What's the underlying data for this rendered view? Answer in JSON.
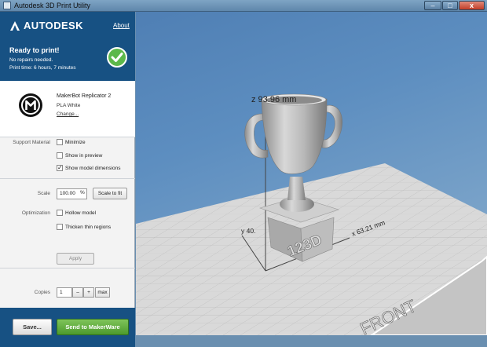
{
  "window": {
    "title": "Autodesk 3D Print Utility",
    "controls": {
      "minimize": "–",
      "maximize": "□",
      "close": "x"
    }
  },
  "brand": {
    "logo_text": "AUTODESK",
    "about_link": "About",
    "accent_color": "#175183"
  },
  "status": {
    "title": "Ready to print!",
    "repairs": "No repairs needed.",
    "print_time": "Print time: 6 hours, 7 minutes",
    "icon": "check-icon",
    "color": "#5cb84a"
  },
  "printer": {
    "name": "MakerBot Replicator 2",
    "material": "PLA White",
    "change_link": "Change..."
  },
  "support_material": {
    "label": "Support Material",
    "options": [
      {
        "label": "Minimize",
        "checked": false
      },
      {
        "label": "Show in preview",
        "checked": false
      },
      {
        "label": "Show model dimensions",
        "checked": true
      }
    ]
  },
  "scale": {
    "label": "Scale",
    "value": "100.00",
    "unit": "%",
    "fit_button": "Scale to fit"
  },
  "optimization": {
    "label": "Optimization",
    "options": [
      {
        "label": "Hollow model",
        "checked": false
      },
      {
        "label": "Thicken thin regions",
        "checked": false
      }
    ],
    "apply_button": "Apply"
  },
  "copies": {
    "label": "Copies",
    "value": "1",
    "minus": "–",
    "plus": "+",
    "max": "max"
  },
  "footer": {
    "save_button": "Save...",
    "send_button": "Send to MakerWare",
    "send_color": "#5aaa38"
  },
  "viewport": {
    "z_dimension": "z 93.96 mm",
    "x_dimension": "x 63.21 mm",
    "y_dimension": "y 40.",
    "model_label": "123D",
    "platform_label": "FRONT"
  }
}
